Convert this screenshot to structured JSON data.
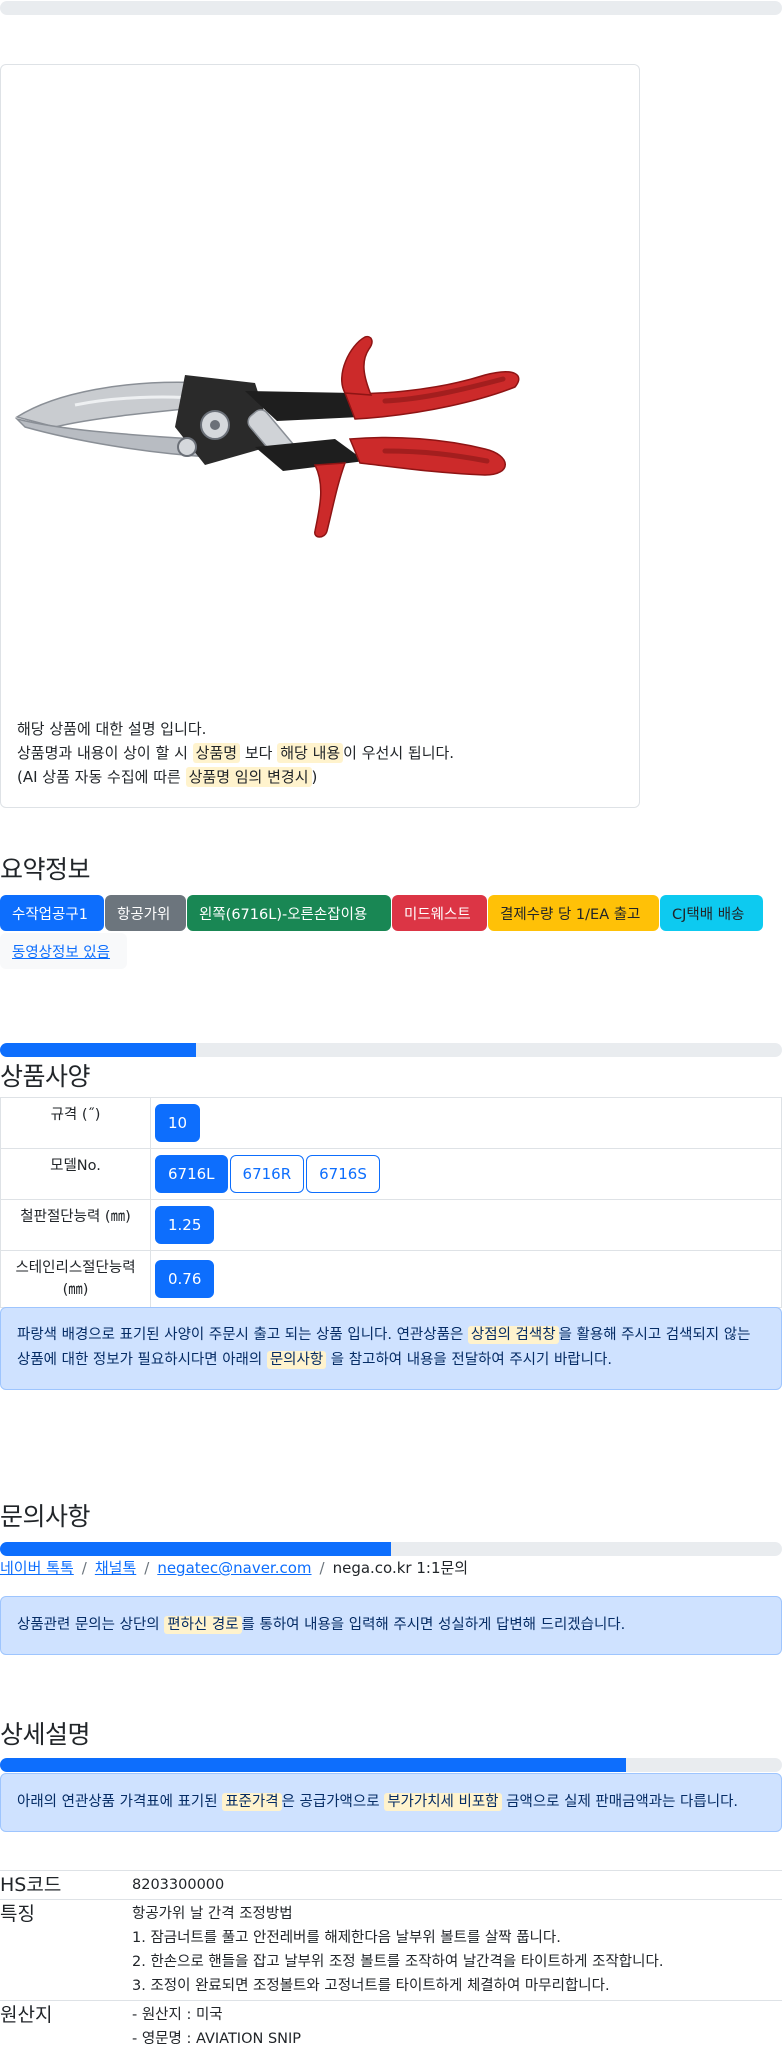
{
  "image_caption": {
    "line1": "해당 상품에 대한 설명 입니다.",
    "line2_a": "상품명과 내용이 상이 할 시 ",
    "line2_hl1": "상품명",
    "line2_b": " 보다 ",
    "line2_hl2": "해당 내용",
    "line2_c": "이 우선시 됩니다.",
    "line3_a": "(AI 상품 자동 수집에 따른 ",
    "line3_hl": "상품명 임의 변경시",
    "line3_b": ")"
  },
  "summary": {
    "title": "요약정보",
    "badges": [
      {
        "label": "수작업공구1",
        "color": "#0d6efd"
      },
      {
        "label": "항공가위",
        "color": "#6c757d"
      },
      {
        "label": "왼쪽(6716L)-오른손잡이용",
        "color": "#198754"
      },
      {
        "label": "미드웨스트",
        "color": "#dc3545"
      },
      {
        "label": "결제수량 당 1/EA 출고",
        "color": "#ffc107"
      },
      {
        "label": "CJ택배 배송",
        "color": "#0dcaf0"
      },
      {
        "label": "동영상정보 있음",
        "color": "#f8f9fa"
      }
    ]
  },
  "spec": {
    "title": "상품사양",
    "progress": 0.25,
    "rows": [
      {
        "key": "규격 (˝)",
        "values": [
          "10"
        ]
      },
      {
        "key": "모델No.",
        "values": [
          "6716L",
          "6716R",
          "6716S"
        ]
      },
      {
        "key": "철판절단능력 (㎜)",
        "values": [
          "1.25"
        ]
      },
      {
        "key_line1": "스테인리스절단능력",
        "key_line2": "(㎜)",
        "values": [
          "0.76"
        ]
      }
    ],
    "alert_a": "파랑색 배경으로 표기된 사양이 주문시 출고 되는 상품 입니다. 연관상품은 ",
    "alert_hl1": "상점의 검색창",
    "alert_b": "을 활용해 주시고 검색되지 않는 상품에 대한 정보가 필요하시다면 아래의 ",
    "alert_hl2": "문의사항",
    "alert_c": " 을 참고하여 내용을 전달하여 주시기 바랍니다."
  },
  "inquiry": {
    "title": "문의사항",
    "progress": 0.5,
    "links": [
      "네이버 톡톡",
      "채널톡",
      "negatec@naver.com"
    ],
    "plain": "nega.co.kr 1:1문의",
    "sep": "/",
    "alert_a": "상품관련 문의는 상단의 ",
    "alert_hl": "편하신 경로",
    "alert_b": "를 통하여 내용을 입력해 주시면 성실하게 답변해 드리겠습니다."
  },
  "detail": {
    "title": "상세설명",
    "progress": 0.8,
    "alert_a": "아래의 연관상품 가격표에 표기된 ",
    "alert_hl1": "표준가격",
    "alert_b": "은 공급가액으로 ",
    "alert_hl2": "부가가치세 비포함",
    "alert_c": " 금액으로 실제 판매금액과는 다릅니다.",
    "rows": [
      {
        "key": "HS코드",
        "lines": [
          "8203300000"
        ]
      },
      {
        "key": "특징",
        "lines": [
          "항공가위 날 간격 조정방법",
          "1. 잠금너트를 풀고 안전레버를 해제한다음 날부위 볼트를 살짝 풉니다.",
          "2. 한손으로 핸들을 잡고 날부위 조정 볼트를 조작하여 날간격을 타이트하게 조작합니다.",
          "3. 조정이 완료되면 조정볼트와 고정너트를 타이트하게 체결하여 마무리합니다."
        ]
      },
      {
        "key": "원산지",
        "lines": [
          "- 원산지 : 미국",
          "- 영문명 : AVIATION SNIP"
        ]
      }
    ]
  }
}
